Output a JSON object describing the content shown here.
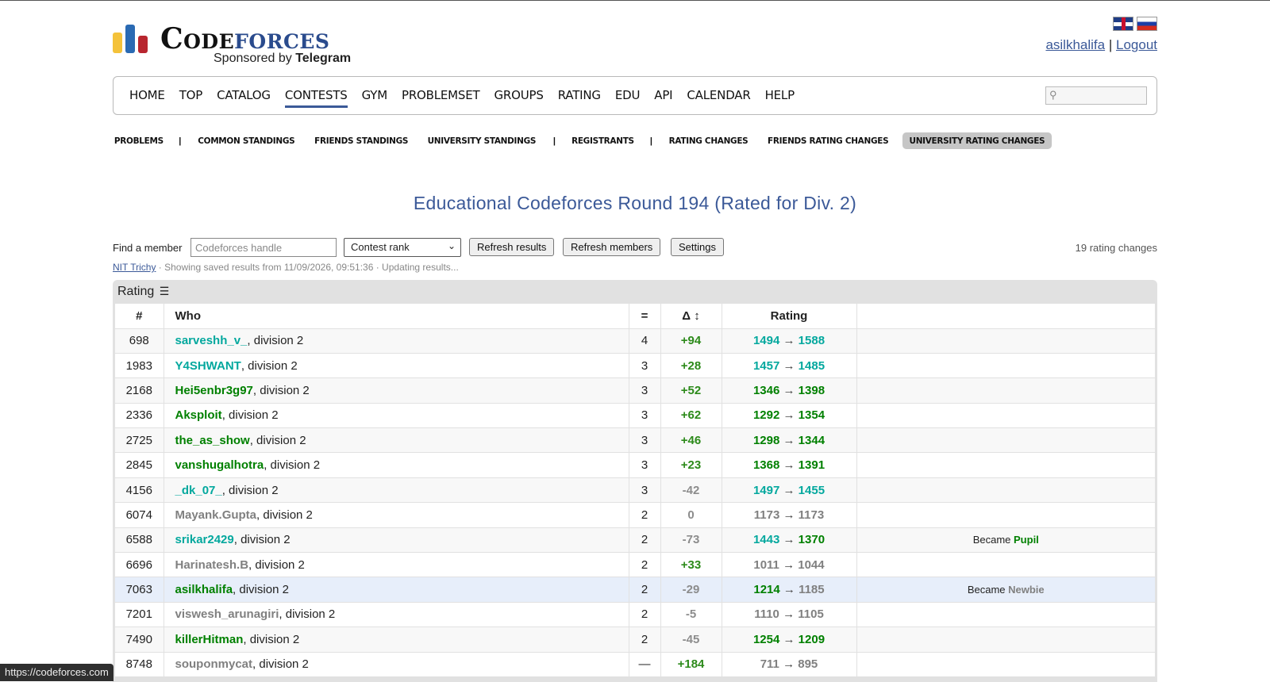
{
  "brand": {
    "name_part1": "Code",
    "name_part2": "forces",
    "sponsor_prefix": "Sponsored by",
    "sponsor_name": "Telegram"
  },
  "user": {
    "handle": "asilkhalifa",
    "separator": "|",
    "logout": "Logout"
  },
  "main_nav": [
    "HOME",
    "TOP",
    "CATALOG",
    "CONTESTS",
    "GYM",
    "PROBLEMSET",
    "GROUPS",
    "RATING",
    "EDU",
    "API",
    "CALENDAR",
    "HELP"
  ],
  "main_nav_active": "CONTESTS",
  "sub_nav": {
    "problems": "PROBLEMS",
    "common": "COMMON STANDINGS",
    "friends": "FRIENDS STANDINGS",
    "university": "UNIVERSITY STANDINGS",
    "registrants": "REGISTRANTS",
    "rating_changes": "RATING CHANGES",
    "friends_rating": "FRIENDS RATING CHANGES",
    "university_rating": "UNIVERSITY RATING CHANGES",
    "sep": "|"
  },
  "contest_title": "Educational Codeforces Round 194 (Rated for Div. 2)",
  "filters": {
    "find_label": "Find a member",
    "handle_placeholder": "Codeforces handle",
    "sort_value": "Contest rank",
    "refresh_results": "Refresh results",
    "refresh_members": "Refresh members",
    "settings": "Settings",
    "count": "19 rating changes"
  },
  "status": {
    "org": "NIT Trichy",
    "text": " · Showing saved results from 11/09/2026, 09:51:36 · Updating results..."
  },
  "table": {
    "caption": "Rating",
    "headers": {
      "rank": "#",
      "who": "Who",
      "eq": "=",
      "delta": "Δ",
      "rating": "Rating"
    },
    "rows": [
      {
        "rank": "698",
        "handle": "sarveshh_v_",
        "div": ", division 2",
        "eq": "4",
        "delta": "+94",
        "old": "1494",
        "new": "1588",
        "hc": "#03a89e",
        "oc": "#03a89e",
        "nc": "#03a89e",
        "note": "",
        "note_rank": ""
      },
      {
        "rank": "1983",
        "handle": "Y4SHWANT",
        "div": ", division 2",
        "eq": "3",
        "delta": "+28",
        "old": "1457",
        "new": "1485",
        "hc": "#03a89e",
        "oc": "#03a89e",
        "nc": "#03a89e",
        "note": "",
        "note_rank": ""
      },
      {
        "rank": "2168",
        "handle": "Hei5enbr3g97",
        "div": ", division 2",
        "eq": "3",
        "delta": "+52",
        "old": "1346",
        "new": "1398",
        "hc": "#008000",
        "oc": "#008000",
        "nc": "#008000",
        "note": "",
        "note_rank": ""
      },
      {
        "rank": "2336",
        "handle": "Aksploit",
        "div": ", division 2",
        "eq": "3",
        "delta": "+62",
        "old": "1292",
        "new": "1354",
        "hc": "#008000",
        "oc": "#008000",
        "nc": "#008000",
        "note": "",
        "note_rank": ""
      },
      {
        "rank": "2725",
        "handle": "the_as_show",
        "div": ", division 2",
        "eq": "3",
        "delta": "+46",
        "old": "1298",
        "new": "1344",
        "hc": "#008000",
        "oc": "#008000",
        "nc": "#008000",
        "note": "",
        "note_rank": ""
      },
      {
        "rank": "2845",
        "handle": "vanshugalhotra",
        "div": ", division 2",
        "eq": "3",
        "delta": "+23",
        "old": "1368",
        "new": "1391",
        "hc": "#008000",
        "oc": "#008000",
        "nc": "#008000",
        "note": "",
        "note_rank": ""
      },
      {
        "rank": "4156",
        "handle": "_dk_07_",
        "div": ", division 2",
        "eq": "3",
        "delta": "-42",
        "old": "1497",
        "new": "1455",
        "hc": "#03a89e",
        "oc": "#03a89e",
        "nc": "#03a89e",
        "note": "",
        "note_rank": ""
      },
      {
        "rank": "6074",
        "handle": "Mayank.Gupta",
        "div": ", division 2",
        "eq": "2",
        "delta": "0",
        "old": "1173",
        "new": "1173",
        "hc": "#808080",
        "oc": "#808080",
        "nc": "#808080",
        "note": "",
        "note_rank": ""
      },
      {
        "rank": "6588",
        "handle": "srikar2429",
        "div": ", division 2",
        "eq": "2",
        "delta": "-73",
        "old": "1443",
        "new": "1370",
        "hc": "#03a89e",
        "oc": "#03a89e",
        "nc": "#008000",
        "note": "Became ",
        "note_rank": "Pupil",
        "note_color": "#008000"
      },
      {
        "rank": "6696",
        "handle": "Harinatesh.B",
        "div": ", division 2",
        "eq": "2",
        "delta": "+33",
        "old": "1011",
        "new": "1044",
        "hc": "#808080",
        "oc": "#808080",
        "nc": "#808080",
        "note": "",
        "note_rank": ""
      },
      {
        "rank": "7063",
        "handle": "asilkhalifa",
        "div": ", division 2",
        "eq": "2",
        "delta": "-29",
        "old": "1214",
        "new": "1185",
        "hc": "#008000",
        "oc": "#008000",
        "nc": "#808080",
        "note": "Became ",
        "note_rank": "Newbie",
        "note_color": "#808080",
        "highlight": true
      },
      {
        "rank": "7201",
        "handle": "viswesh_arunagiri",
        "div": ", division 2",
        "eq": "2",
        "delta": "-5",
        "old": "1110",
        "new": "1105",
        "hc": "#808080",
        "oc": "#808080",
        "nc": "#808080",
        "note": "",
        "note_rank": ""
      },
      {
        "rank": "7490",
        "handle": "killerHitman",
        "div": ", division 2",
        "eq": "2",
        "delta": "-45",
        "old": "1254",
        "new": "1209",
        "hc": "#008000",
        "oc": "#008000",
        "nc": "#008000",
        "note": "",
        "note_rank": ""
      },
      {
        "rank": "8748",
        "handle": "souponmycat",
        "div": ", division 2",
        "eq": "—",
        "delta": "+184",
        "old": "711",
        "new": "895",
        "hc": "#808080",
        "oc": "#808080",
        "nc": "#808080",
        "note": "",
        "note_rank": ""
      }
    ]
  },
  "status_bar_url": "https://codeforces.com"
}
